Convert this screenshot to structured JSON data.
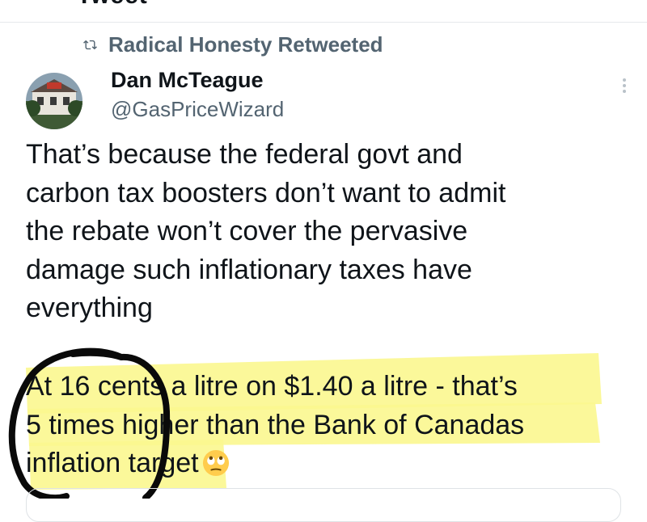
{
  "header": {
    "partial_title": "Tweet"
  },
  "retweet": {
    "label": "Radical Honesty Retweeted",
    "icon": "retweet-icon"
  },
  "author": {
    "name": "Dan McTeague",
    "handle": "@GasPriceWizard"
  },
  "tweet": {
    "lines": [
      "That’s because the federal govt and",
      "carbon tax boosters don’t want to admit",
      "the rebate won’t cover the pervasive",
      "damage such inflationary taxes have",
      "everything"
    ],
    "highlighted_lines": [
      "At 16 cents a litre on $1.40 a litre - that’s",
      "5 times higher than the Bank of Canadas",
      "inflation target"
    ],
    "emoji": "eye-roll-emoji"
  },
  "colors": {
    "highlight": "#fbf78f",
    "text": "#0f1419",
    "secondary": "#536471",
    "annotation": "#0a0a0a"
  }
}
